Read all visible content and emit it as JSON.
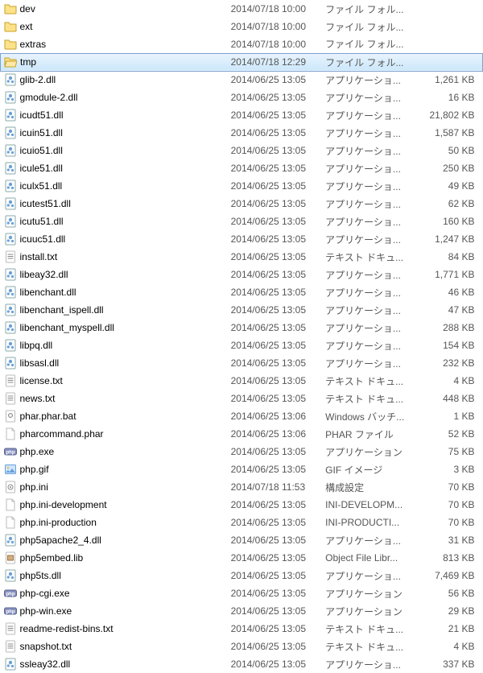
{
  "files": [
    {
      "icon": "folder",
      "name": "dev",
      "date": "2014/07/18 10:00",
      "type": "ファイル フォル...",
      "size": "",
      "selected": false
    },
    {
      "icon": "folder",
      "name": "ext",
      "date": "2014/07/18 10:00",
      "type": "ファイル フォル...",
      "size": "",
      "selected": false
    },
    {
      "icon": "folder",
      "name": "extras",
      "date": "2014/07/18 10:00",
      "type": "ファイル フォル...",
      "size": "",
      "selected": false
    },
    {
      "icon": "folder-open",
      "name": "tmp",
      "date": "2014/07/18 12:29",
      "type": "ファイル フォル...",
      "size": "",
      "selected": true
    },
    {
      "icon": "dll",
      "name": "glib-2.dll",
      "date": "2014/06/25 13:05",
      "type": "アプリケーショ...",
      "size": "1,261 KB",
      "selected": false
    },
    {
      "icon": "dll",
      "name": "gmodule-2.dll",
      "date": "2014/06/25 13:05",
      "type": "アプリケーショ...",
      "size": "16 KB",
      "selected": false
    },
    {
      "icon": "dll",
      "name": "icudt51.dll",
      "date": "2014/06/25 13:05",
      "type": "アプリケーショ...",
      "size": "21,802 KB",
      "selected": false
    },
    {
      "icon": "dll",
      "name": "icuin51.dll",
      "date": "2014/06/25 13:05",
      "type": "アプリケーショ...",
      "size": "1,587 KB",
      "selected": false
    },
    {
      "icon": "dll",
      "name": "icuio51.dll",
      "date": "2014/06/25 13:05",
      "type": "アプリケーショ...",
      "size": "50 KB",
      "selected": false
    },
    {
      "icon": "dll",
      "name": "icule51.dll",
      "date": "2014/06/25 13:05",
      "type": "アプリケーショ...",
      "size": "250 KB",
      "selected": false
    },
    {
      "icon": "dll",
      "name": "iculx51.dll",
      "date": "2014/06/25 13:05",
      "type": "アプリケーショ...",
      "size": "49 KB",
      "selected": false
    },
    {
      "icon": "dll",
      "name": "icutest51.dll",
      "date": "2014/06/25 13:05",
      "type": "アプリケーショ...",
      "size": "62 KB",
      "selected": false
    },
    {
      "icon": "dll",
      "name": "icutu51.dll",
      "date": "2014/06/25 13:05",
      "type": "アプリケーショ...",
      "size": "160 KB",
      "selected": false
    },
    {
      "icon": "dll",
      "name": "icuuc51.dll",
      "date": "2014/06/25 13:05",
      "type": "アプリケーショ...",
      "size": "1,247 KB",
      "selected": false
    },
    {
      "icon": "txt",
      "name": "install.txt",
      "date": "2014/06/25 13:05",
      "type": "テキスト ドキュ...",
      "size": "84 KB",
      "selected": false
    },
    {
      "icon": "dll",
      "name": "libeay32.dll",
      "date": "2014/06/25 13:05",
      "type": "アプリケーショ...",
      "size": "1,771 KB",
      "selected": false
    },
    {
      "icon": "dll",
      "name": "libenchant.dll",
      "date": "2014/06/25 13:05",
      "type": "アプリケーショ...",
      "size": "46 KB",
      "selected": false
    },
    {
      "icon": "dll",
      "name": "libenchant_ispell.dll",
      "date": "2014/06/25 13:05",
      "type": "アプリケーショ...",
      "size": "47 KB",
      "selected": false
    },
    {
      "icon": "dll",
      "name": "libenchant_myspell.dll",
      "date": "2014/06/25 13:05",
      "type": "アプリケーショ...",
      "size": "288 KB",
      "selected": false
    },
    {
      "icon": "dll",
      "name": "libpq.dll",
      "date": "2014/06/25 13:05",
      "type": "アプリケーショ...",
      "size": "154 KB",
      "selected": false
    },
    {
      "icon": "dll",
      "name": "libsasl.dll",
      "date": "2014/06/25 13:05",
      "type": "アプリケーショ...",
      "size": "232 KB",
      "selected": false
    },
    {
      "icon": "txt",
      "name": "license.txt",
      "date": "2014/06/25 13:05",
      "type": "テキスト ドキュ...",
      "size": "4 KB",
      "selected": false
    },
    {
      "icon": "txt",
      "name": "news.txt",
      "date": "2014/06/25 13:05",
      "type": "テキスト ドキュ...",
      "size": "448 KB",
      "selected": false
    },
    {
      "icon": "bat",
      "name": "phar.phar.bat",
      "date": "2014/06/25 13:06",
      "type": "Windows バッチ...",
      "size": "1 KB",
      "selected": false
    },
    {
      "icon": "file",
      "name": "pharcommand.phar",
      "date": "2014/06/25 13:06",
      "type": "PHAR ファイル",
      "size": "52 KB",
      "selected": false
    },
    {
      "icon": "php",
      "name": "php.exe",
      "date": "2014/06/25 13:05",
      "type": "アプリケーション",
      "size": "75 KB",
      "selected": false
    },
    {
      "icon": "gif",
      "name": "php.gif",
      "date": "2014/06/25 13:05",
      "type": "GIF イメージ",
      "size": "3 KB",
      "selected": false
    },
    {
      "icon": "ini",
      "name": "php.ini",
      "date": "2014/07/18 11:53",
      "type": "構成設定",
      "size": "70 KB",
      "selected": false
    },
    {
      "icon": "file",
      "name": "php.ini-development",
      "date": "2014/06/25 13:05",
      "type": "INI-DEVELOPM...",
      "size": "70 KB",
      "selected": false
    },
    {
      "icon": "file",
      "name": "php.ini-production",
      "date": "2014/06/25 13:05",
      "type": "INI-PRODUCTI...",
      "size": "70 KB",
      "selected": false
    },
    {
      "icon": "dll",
      "name": "php5apache2_4.dll",
      "date": "2014/06/25 13:05",
      "type": "アプリケーショ...",
      "size": "31 KB",
      "selected": false
    },
    {
      "icon": "lib",
      "name": "php5embed.lib",
      "date": "2014/06/25 13:05",
      "type": "Object File Libr...",
      "size": "813 KB",
      "selected": false
    },
    {
      "icon": "dll",
      "name": "php5ts.dll",
      "date": "2014/06/25 13:05",
      "type": "アプリケーショ...",
      "size": "7,469 KB",
      "selected": false
    },
    {
      "icon": "php",
      "name": "php-cgi.exe",
      "date": "2014/06/25 13:05",
      "type": "アプリケーション",
      "size": "56 KB",
      "selected": false
    },
    {
      "icon": "php",
      "name": "php-win.exe",
      "date": "2014/06/25 13:05",
      "type": "アプリケーション",
      "size": "29 KB",
      "selected": false
    },
    {
      "icon": "txt",
      "name": "readme-redist-bins.txt",
      "date": "2014/06/25 13:05",
      "type": "テキスト ドキュ...",
      "size": "21 KB",
      "selected": false
    },
    {
      "icon": "txt",
      "name": "snapshot.txt",
      "date": "2014/06/25 13:05",
      "type": "テキスト ドキュ...",
      "size": "4 KB",
      "selected": false
    },
    {
      "icon": "dll",
      "name": "ssleay32.dll",
      "date": "2014/06/25 13:05",
      "type": "アプリケーショ...",
      "size": "337 KB",
      "selected": false
    }
  ]
}
